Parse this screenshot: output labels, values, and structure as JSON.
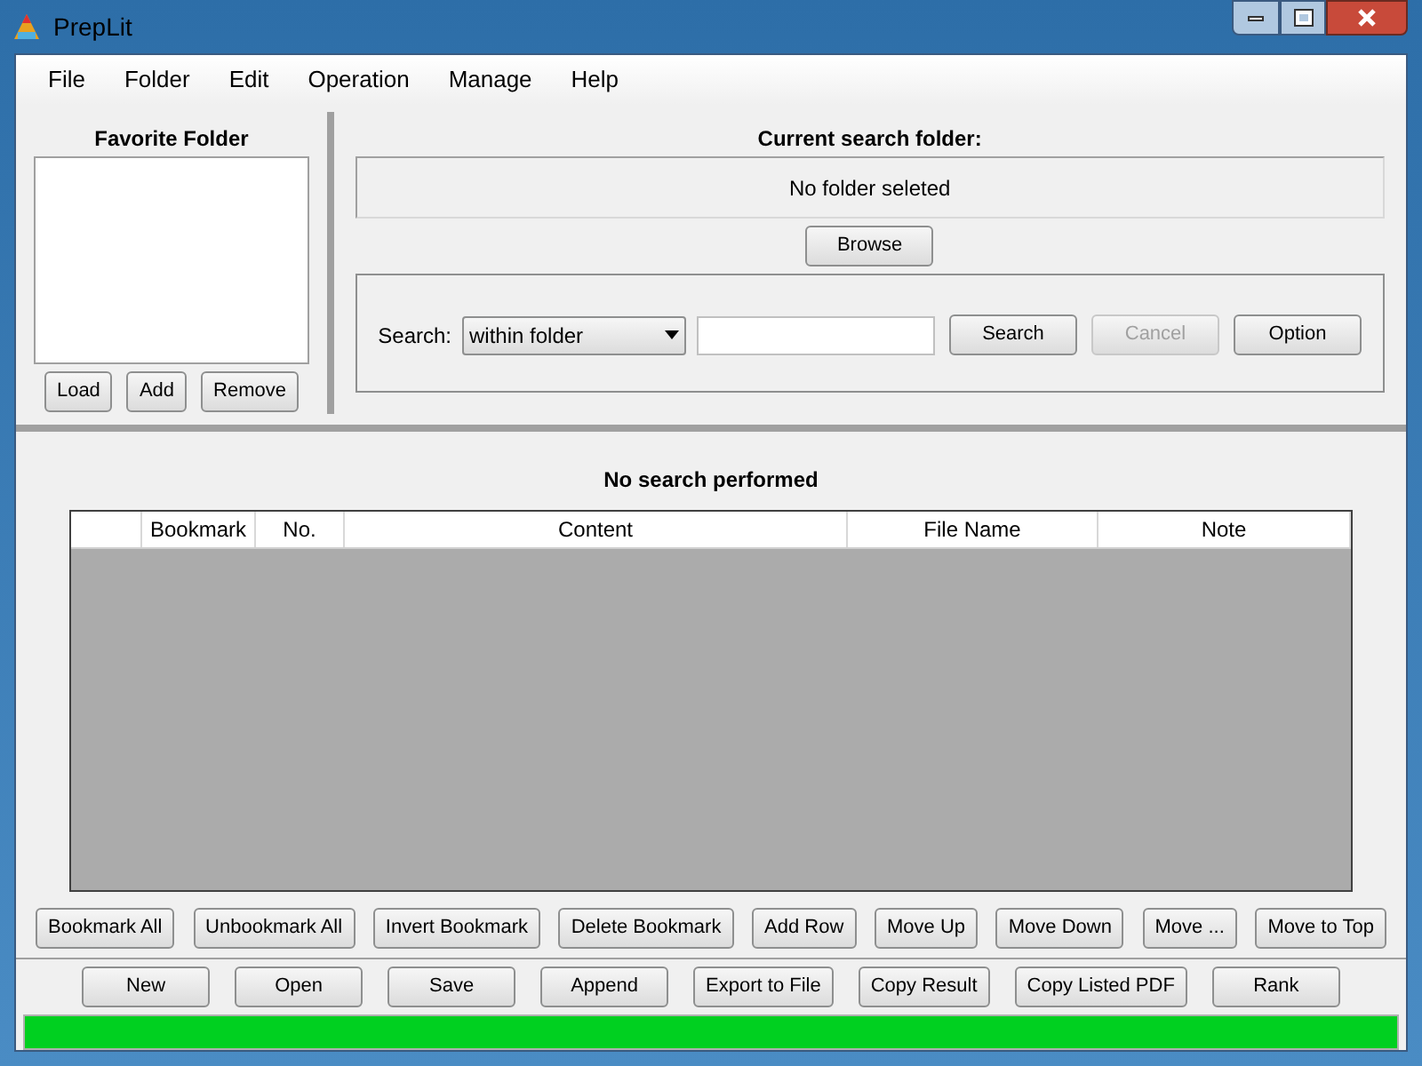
{
  "window": {
    "title": "PrepLit"
  },
  "menu": [
    "File",
    "Folder",
    "Edit",
    "Operation",
    "Manage",
    "Help"
  ],
  "favorites": {
    "title": "Favorite Folder",
    "buttons": [
      "Load",
      "Add",
      "Remove"
    ]
  },
  "search_folder": {
    "title": "Current search folder:",
    "value": "No folder seleted",
    "browse": "Browse"
  },
  "search": {
    "label": "Search:",
    "scope": "within folder",
    "buttons": [
      {
        "label": "Search",
        "disabled": false
      },
      {
        "label": "Cancel",
        "disabled": true
      },
      {
        "label": "Option",
        "disabled": false
      }
    ]
  },
  "results": {
    "status": "No search performed",
    "columns": [
      "",
      "Bookmark",
      "No.",
      "Content",
      "File Name",
      "Note"
    ]
  },
  "row_buttons": [
    "Bookmark All",
    "Unbookmark All",
    "Invert Bookmark",
    "Delete Bookmark",
    "Add Row",
    "Move Up",
    "Move Down",
    "Move ...",
    "Move to Top"
  ],
  "file_buttons": [
    "New",
    "Open",
    "Save",
    "Append",
    "Export to File",
    "Copy Result",
    "Copy Listed PDF",
    "Rank"
  ],
  "progress": {
    "level": 1
  }
}
